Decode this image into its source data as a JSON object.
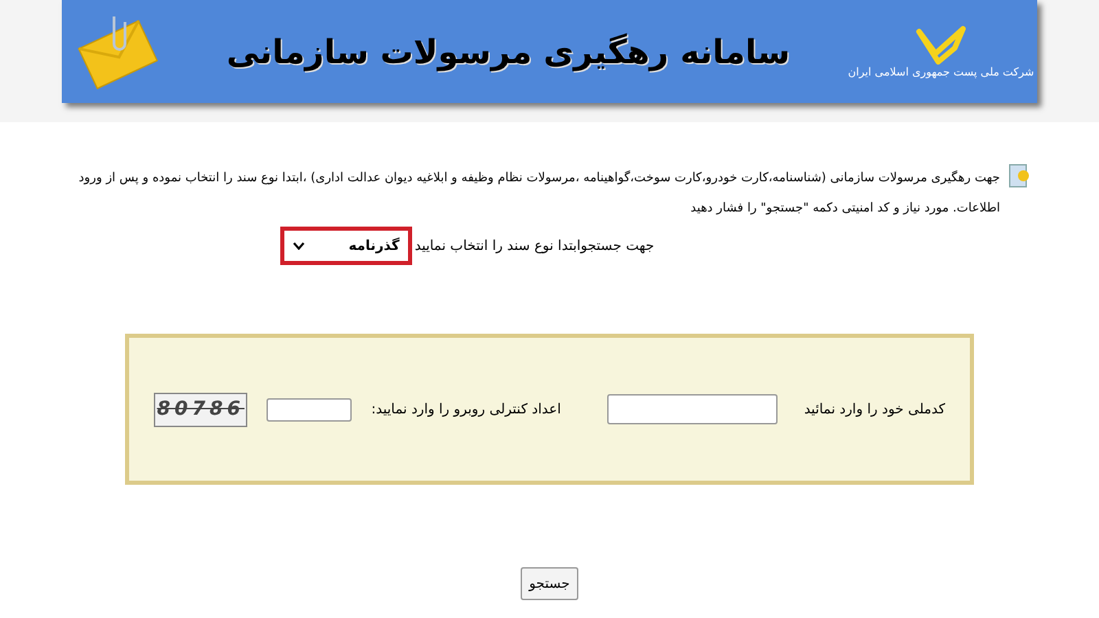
{
  "header": {
    "title": "سامانه رهگیری مرسولات سازمانی",
    "company": "شرکت ملی پست جمهوری اسلامی ایران"
  },
  "intro": "جهت رهگیری مرسولات سازمانی (شناسنامه،کارت خودرو،کارت سوخت،گواهینامه ،مرسولات نظام وظیفه  و ابلاغیه دیوان عدالت اداری) ،ابتدا  نوع سند را انتخاب نموده و پس از ورود اطلاعات. مورد نیاز و کد امنیتی دکمه \"جستجو\" را فشار دهید",
  "doc_type": {
    "label": "جهت جستجوابتدا نوع سند را انتخاب نمایید",
    "value": "گذرنامه"
  },
  "form": {
    "national_code_label": "کدملی خود را وارد نمائید",
    "captcha_label": "اعداد کنترلی روبرو را وارد نمایید:",
    "captcha": "80786"
  },
  "search_button": "جستجو"
}
